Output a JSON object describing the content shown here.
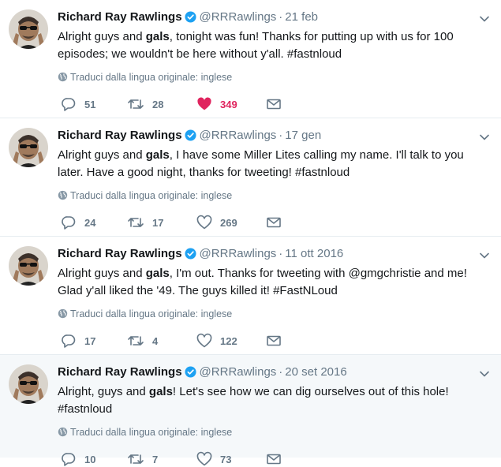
{
  "tweets": [
    {
      "name": "Richard Ray Rawlings",
      "handle": "@RRRawlings",
      "date": "21 feb",
      "text_parts": [
        "Alright guys and ",
        "gals",
        ", tonight was fun! Thanks for putting up with us for 100 episodes; we wouldn't be here without y'all. #fastnloud"
      ],
      "translate": "Traduci dalla lingua originale: inglese",
      "replies": "51",
      "retweets": "28",
      "likes": "349",
      "liked": true
    },
    {
      "name": "Richard Ray Rawlings",
      "handle": "@RRRawlings",
      "date": "17 gen",
      "text_parts": [
        "Alright guys and ",
        "gals",
        ", I have some Miller Lites calling my name. I'll talk to you later. Have a good night, thanks for tweeting! #fastnloud"
      ],
      "translate": "Traduci dalla lingua originale: inglese",
      "replies": "24",
      "retweets": "17",
      "likes": "269",
      "liked": false
    },
    {
      "name": "Richard Ray Rawlings",
      "handle": "@RRRawlings",
      "date": "11 ott 2016",
      "text_parts": [
        "Alright guys and ",
        "gals",
        ", I'm out. Thanks for tweeting with @gmgchristie and me! Glad y'all liked the '49. The guys killed it! #FastNLoud"
      ],
      "translate": "Traduci dalla lingua originale: inglese",
      "replies": "17",
      "retweets": "4",
      "likes": "122",
      "liked": false
    },
    {
      "name": "Richard Ray Rawlings",
      "handle": "@RRRawlings",
      "date": "20 set 2016",
      "text_parts": [
        "Alright, guys and ",
        "gals",
        "! Let's see how we can dig ourselves out of this hole! #fastnloud"
      ],
      "translate": "Traduci dalla lingua originale: inglese",
      "replies": "10",
      "retweets": "7",
      "likes": "73",
      "liked": false
    }
  ],
  "icons": {
    "verified": "verified-badge-icon",
    "caret": "chevron-down-icon",
    "globe": "globe-icon",
    "reply": "reply-icon",
    "retweet": "retweet-icon",
    "like": "heart-icon",
    "dm": "envelope-icon"
  },
  "colors": {
    "text": "#14171a",
    "muted": "#657786",
    "verified": "#1da1f2",
    "like_active": "#e0245e",
    "highlight_bg": "#f5f8fa",
    "divider": "#e6ecf0"
  }
}
